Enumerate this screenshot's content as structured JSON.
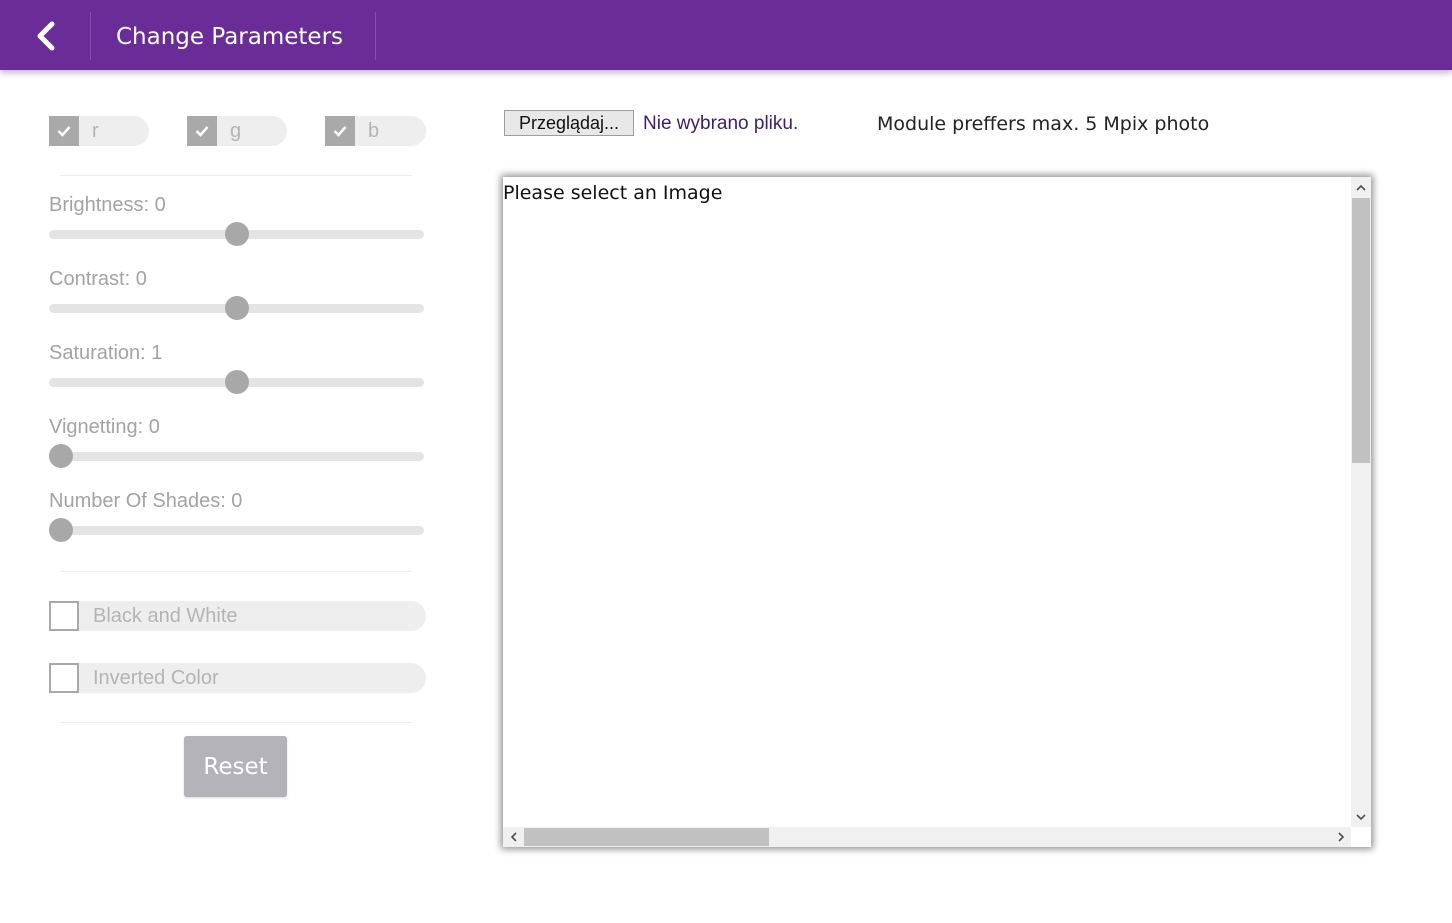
{
  "header": {
    "title": "Change Parameters"
  },
  "channels": [
    {
      "label": "r",
      "checked": true
    },
    {
      "label": "g",
      "checked": true
    },
    {
      "label": "b",
      "checked": true
    }
  ],
  "sliders": [
    {
      "label": "Brightness: 0",
      "level": 0.5
    },
    {
      "label": "Contrast: 0",
      "level": 0.5
    },
    {
      "label": "Saturation: 1",
      "level": 0.5
    },
    {
      "label": "Vignetting: 0",
      "level": 0
    },
    {
      "label": "Number Of Shades: 0",
      "level": 0
    }
  ],
  "options": [
    {
      "label": "Black and White",
      "checked": false
    },
    {
      "label": "Inverted Color",
      "checked": false
    }
  ],
  "reset_label": "Reset",
  "file": {
    "button_label": "Przeglądaj...",
    "status": "Nie wybrano pliku.",
    "hint": "Module preffers max. 5 Mpix photo"
  },
  "image_area": {
    "placeholder": "Please select an Image"
  },
  "colors": {
    "header": "#6a2c96",
    "checkbox": "#a9a9a9",
    "slider_thumb": "#a8a8a8",
    "reset_button": "#b3b3b8",
    "file_status": "#3e1d6c"
  },
  "icons": {
    "back": "chevron-left-icon",
    "check": "checkmark-icon",
    "scroll_up": "chevron-up-icon",
    "scroll_down": "chevron-down-icon",
    "scroll_left": "chevron-left-icon",
    "scroll_right": "chevron-right-icon"
  }
}
